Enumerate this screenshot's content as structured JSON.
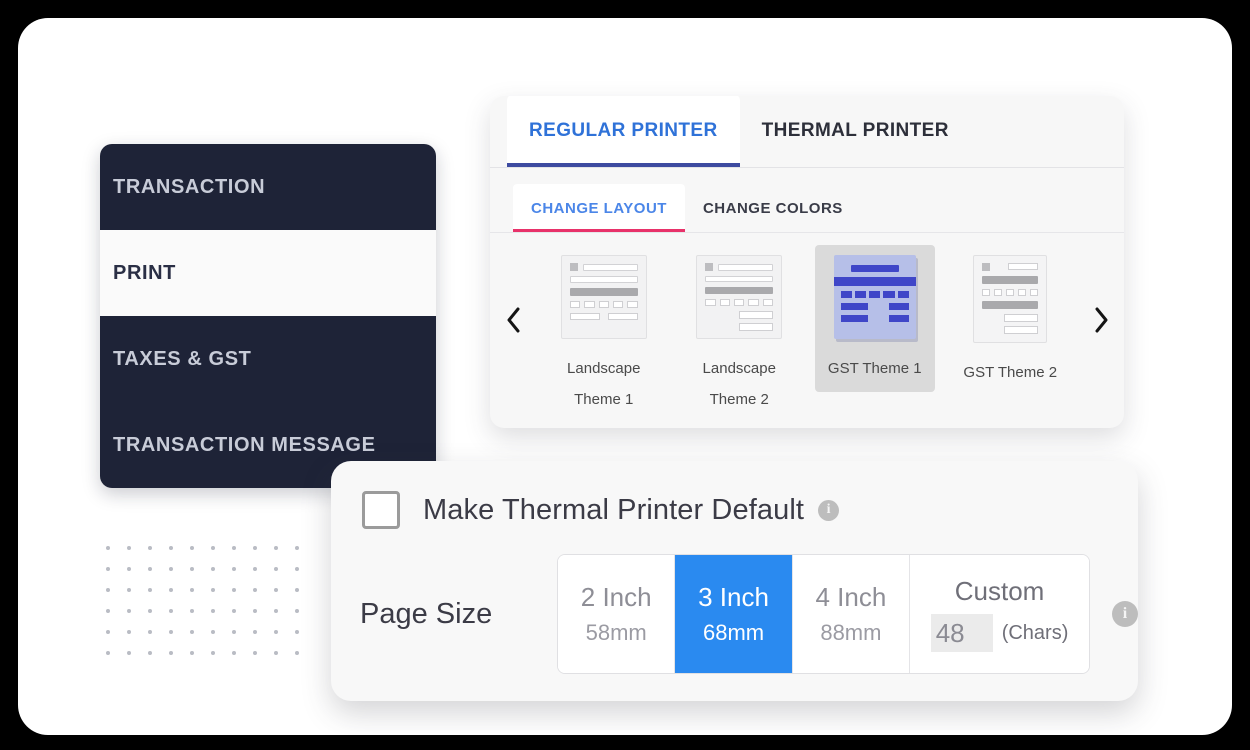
{
  "sidebar": {
    "items": [
      {
        "label": "TRANSACTION",
        "active": false
      },
      {
        "label": "PRINT",
        "active": true
      },
      {
        "label": "TAXES & GST",
        "active": false
      },
      {
        "label": "TRANSACTION MESSAGE",
        "active": false
      }
    ]
  },
  "printer_panel": {
    "tabs": [
      {
        "label": "REGULAR PRINTER",
        "active": true
      },
      {
        "label": "THERMAL PRINTER",
        "active": false
      }
    ],
    "subtabs": [
      {
        "label": "CHANGE LAYOUT",
        "active": true
      },
      {
        "label": "CHANGE COLORS",
        "active": false
      }
    ],
    "prev_icon": "chevron-left-icon",
    "next_icon": "chevron-right-icon",
    "themes": [
      {
        "line1": "Landscape",
        "line2": "Theme 1",
        "selected": false,
        "style": "landscape"
      },
      {
        "line1": "Landscape",
        "line2": "Theme 2",
        "selected": false,
        "style": "landscape2"
      },
      {
        "line1": "GST Theme 1",
        "line2": "",
        "selected": true,
        "style": "gst1"
      },
      {
        "line1": "GST Theme 2",
        "line2": "",
        "selected": false,
        "style": "gst2"
      }
    ]
  },
  "thermal_panel": {
    "default_checkbox_label": "Make Thermal Printer Default",
    "default_checkbox_checked": false,
    "default_info_icon": "info-icon",
    "info_glyph": "i",
    "page_size_label": "Page Size",
    "size_info_icon": "info-icon",
    "sizes": [
      {
        "title": "2 Inch",
        "sub": "58mm",
        "selected": false
      },
      {
        "title": "3 Inch",
        "sub": "68mm",
        "selected": true
      },
      {
        "title": "4 Inch",
        "sub": "88mm",
        "selected": false
      }
    ],
    "custom": {
      "title": "Custom",
      "value": "48",
      "placeholder": "48",
      "unit": "(Chars)"
    }
  },
  "colors": {
    "sidebar_bg": "#1e2337",
    "sidebar_active_bg": "#fafafa",
    "tab_accent": "#3d4ba0",
    "subtab_accent": "#e8326a",
    "tab_text_active": "#2f72d8",
    "selected_size_bg": "#2a8af0",
    "theme_selected_bg": "#dadada",
    "gst_thumb_bg": "#b6bfe8",
    "gst_thumb_fg": "#3f46c8",
    "page_bg": "#ffffff",
    "frame_bg": "#000000"
  }
}
